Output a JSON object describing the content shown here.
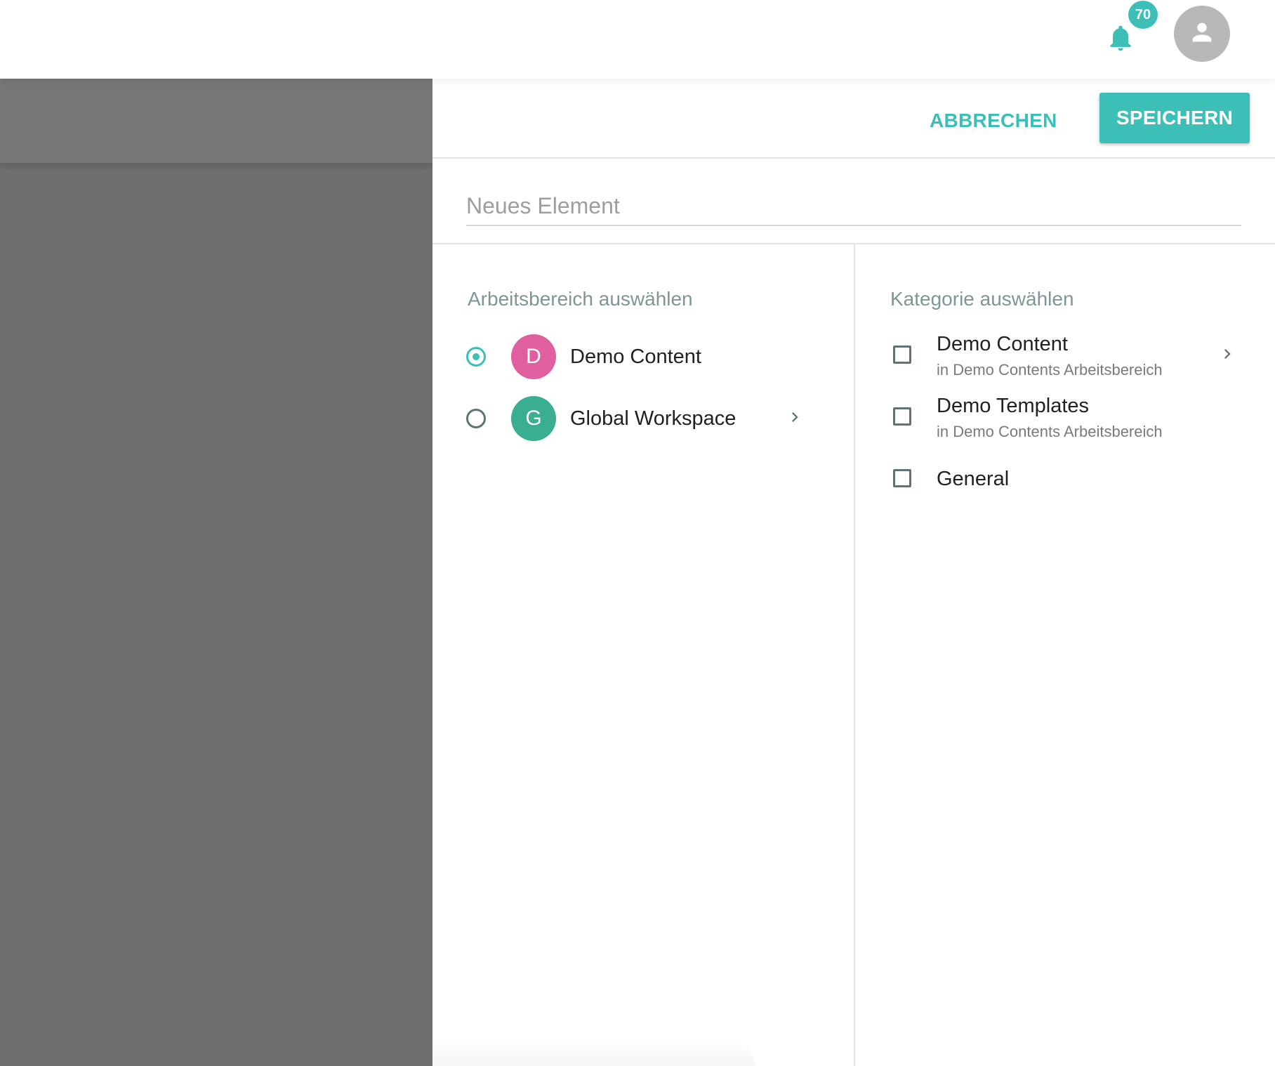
{
  "header": {
    "notification_count": "70",
    "bell_icon": "bell-icon",
    "avatar_icon": "person-icon"
  },
  "actions": {
    "cancel_label": "ABBRECHEN",
    "save_label": "SPEICHERN"
  },
  "title_field": {
    "placeholder": "Neues Element",
    "value": ""
  },
  "workspace": {
    "heading": "Arbeitsbereich auswählen",
    "items": [
      {
        "initial": "D",
        "label": "Demo Content",
        "selected": true,
        "color": "#e0609f",
        "has_children": false
      },
      {
        "initial": "G",
        "label": "Global Workspace",
        "selected": false,
        "color": "#3aae91",
        "has_children": true
      }
    ]
  },
  "category": {
    "heading": "Kategorie auswählen",
    "items": [
      {
        "label": "Demo Content",
        "sub": "in Demo Contents Arbeitsbereich",
        "checked": false,
        "has_children": true
      },
      {
        "label": "Demo Templates",
        "sub": "in Demo Contents Arbeitsbereich",
        "checked": false,
        "has_children": false
      },
      {
        "label": "General",
        "sub": "",
        "checked": false,
        "has_children": false
      }
    ]
  },
  "colors": {
    "accent": "#3bbfb7",
    "backdrop": "#6f6f6f",
    "heading": "#7f9597"
  }
}
